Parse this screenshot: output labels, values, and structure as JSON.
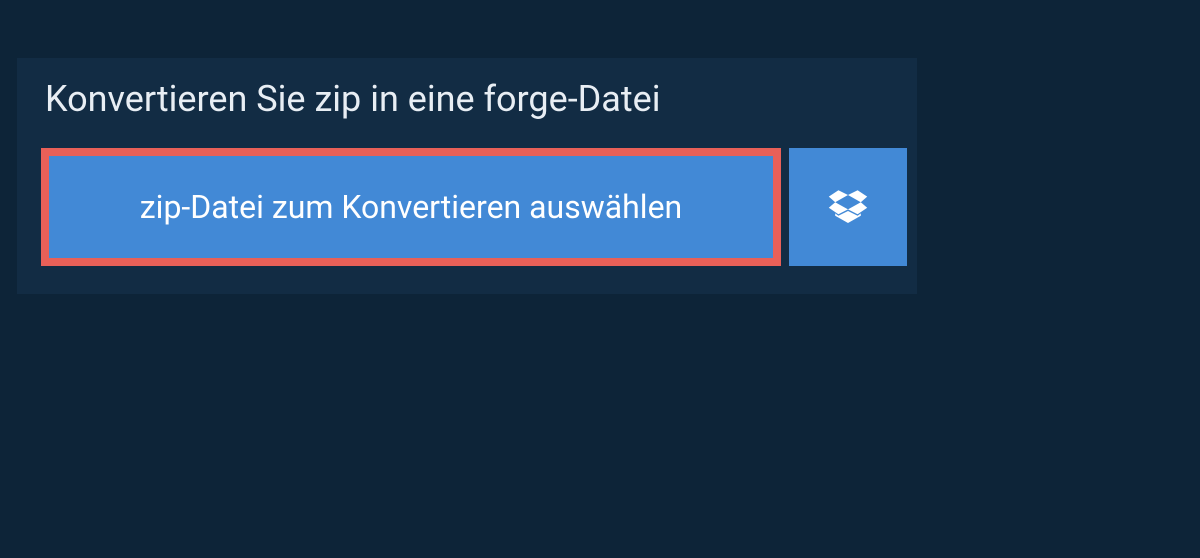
{
  "title": "Konvertieren Sie zip in eine forge-Datei",
  "select_button_label": "zip-Datei zum Konvertieren auswählen"
}
